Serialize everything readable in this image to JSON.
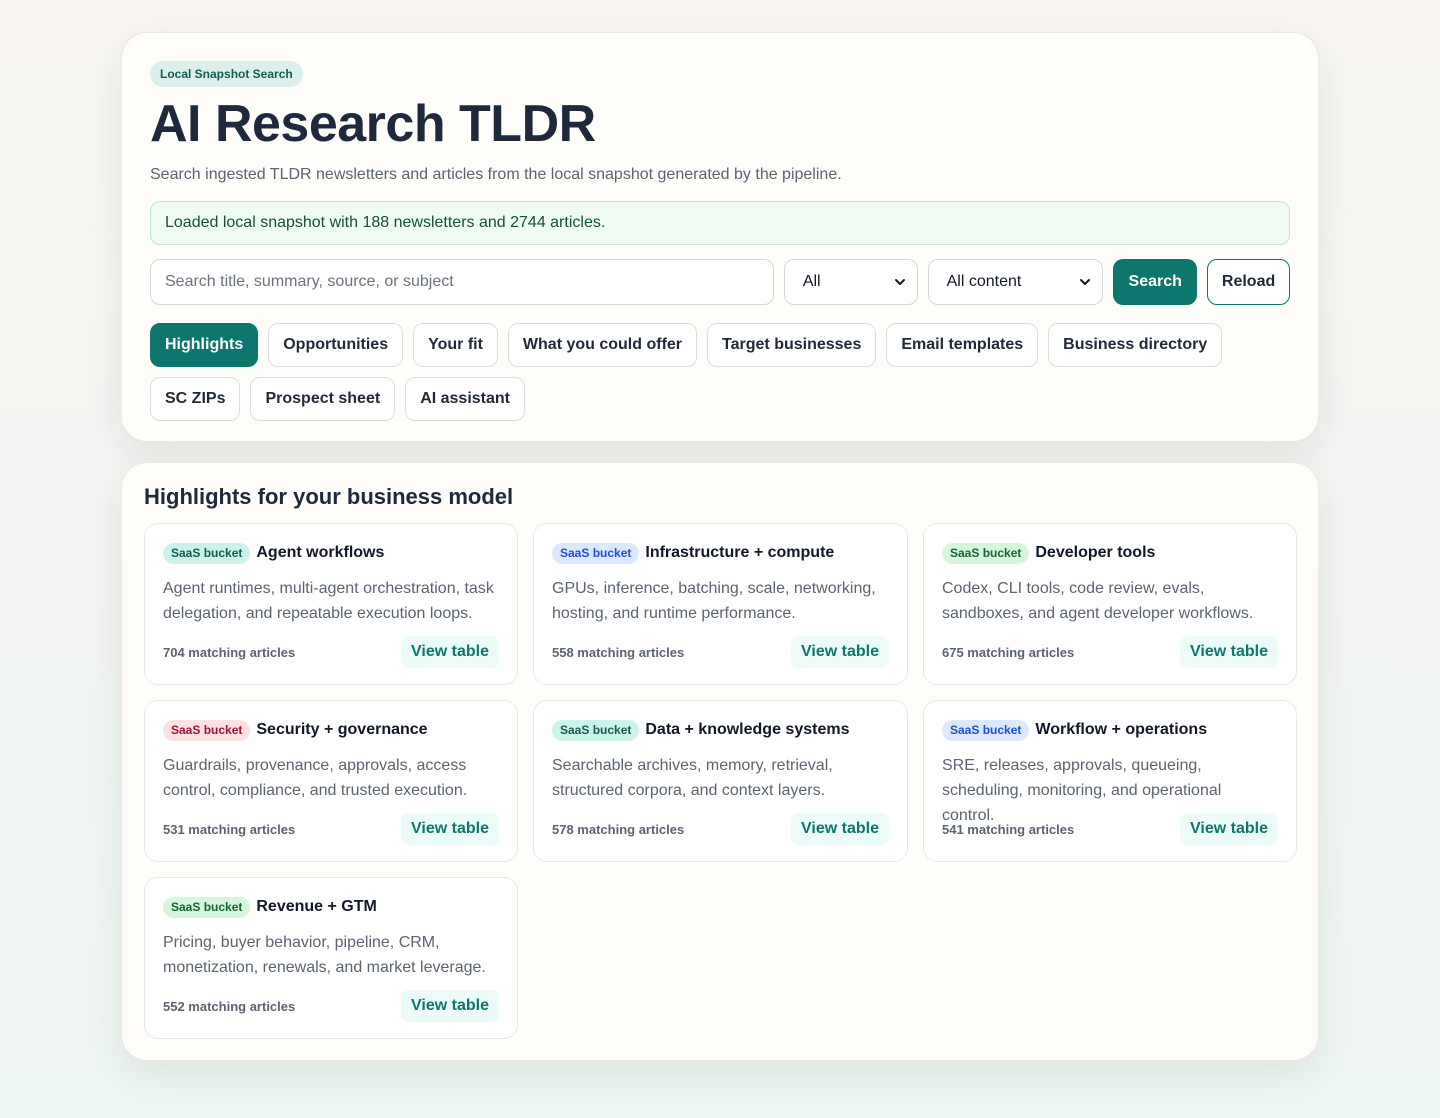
{
  "header": {
    "badge": "Local Snapshot Search",
    "title": "AI Research TLDR",
    "subtitle": "Search ingested TLDR newsletters and articles from the local snapshot generated by the pipeline.",
    "status": "Loaded local snapshot with 188 newsletters and 2744 articles."
  },
  "search": {
    "placeholder": "Search title, summary, source, or subject",
    "value": "",
    "filter_selected": "All",
    "content_selected": "All content",
    "search_label": "Search",
    "reload_label": "Reload"
  },
  "tabs": [
    {
      "label": "Highlights",
      "active": true
    },
    {
      "label": "Opportunities",
      "active": false
    },
    {
      "label": "Your fit",
      "active": false
    },
    {
      "label": "What you could offer",
      "active": false
    },
    {
      "label": "Target businesses",
      "active": false
    },
    {
      "label": "Email templates",
      "active": false
    },
    {
      "label": "Business directory",
      "active": false
    },
    {
      "label": "SC ZIPs",
      "active": false
    },
    {
      "label": "Prospect sheet",
      "active": false
    },
    {
      "label": "AI assistant",
      "active": false
    }
  ],
  "highlights": {
    "title": "Highlights for your business model",
    "view_label": "View table",
    "cards": [
      {
        "bucket": "SaaS bucket",
        "bucket_color": "teal",
        "title": "Agent workflows",
        "description": "Agent runtimes, multi-agent orchestration, task delegation, and repeatable execution loops.",
        "count": "704 matching articles"
      },
      {
        "bucket": "SaaS bucket",
        "bucket_color": "blue",
        "title": "Infrastructure + compute",
        "description": "GPUs, inference, batching, scale, networking, hosting, and runtime performance.",
        "count": "558 matching articles"
      },
      {
        "bucket": "SaaS bucket",
        "bucket_color": "green",
        "title": "Developer tools",
        "description": "Codex, CLI tools, code review, evals, sandboxes, and agent developer workflows.",
        "count": "675 matching articles"
      },
      {
        "bucket": "SaaS bucket",
        "bucket_color": "red",
        "title": "Security + governance",
        "description": "Guardrails, provenance, approvals, access control, compliance, and trusted execution.",
        "count": "531 matching articles"
      },
      {
        "bucket": "SaaS bucket",
        "bucket_color": "teal",
        "title": "Data + knowledge systems",
        "description": "Searchable archives, memory, retrieval, structured corpora, and context layers.",
        "count": "578 matching articles"
      },
      {
        "bucket": "SaaS bucket",
        "bucket_color": "blue",
        "title": "Workflow + operations",
        "description": "SRE, releases, approvals, queueing, scheduling, monitoring, and operational control.",
        "count": "541 matching articles"
      },
      {
        "bucket": "SaaS bucket",
        "bucket_color": "green",
        "title": "Revenue + GTM",
        "description": "Pricing, buyer behavior, pipeline, CRM, monetization, renewals, and market leverage.",
        "count": "552 matching articles"
      }
    ]
  }
}
